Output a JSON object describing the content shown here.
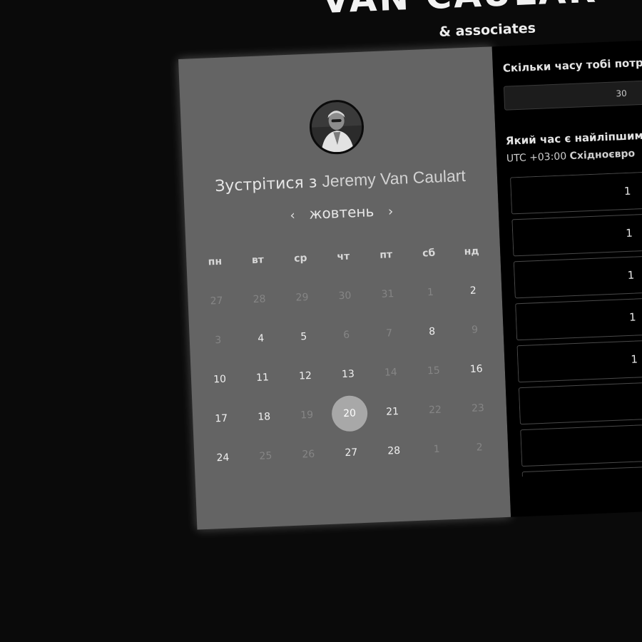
{
  "brand": {
    "title": "VAN CAULAR",
    "subtitle": "& associates"
  },
  "booking": {
    "meet_prefix": "Зустрітися з ",
    "host_name": "Jeremy Van Caulart",
    "month": "жовтень",
    "prev_icon": "chevron-left-icon",
    "next_icon": "chevron-right-icon",
    "weekdays": [
      "пн",
      "вт",
      "ср",
      "чт",
      "пт",
      "сб",
      "нд"
    ],
    "days": [
      {
        "label": "27",
        "muted": true
      },
      {
        "label": "28",
        "muted": true
      },
      {
        "label": "29",
        "muted": true
      },
      {
        "label": "30",
        "muted": true
      },
      {
        "label": "31",
        "muted": true
      },
      {
        "label": "1",
        "muted": true
      },
      {
        "label": "2",
        "muted": false
      },
      {
        "label": "3",
        "muted": true
      },
      {
        "label": "4",
        "muted": false
      },
      {
        "label": "5",
        "muted": false
      },
      {
        "label": "6",
        "muted": true
      },
      {
        "label": "7",
        "muted": true
      },
      {
        "label": "8",
        "muted": false
      },
      {
        "label": "9",
        "muted": true
      },
      {
        "label": "10",
        "muted": false
      },
      {
        "label": "11",
        "muted": false
      },
      {
        "label": "12",
        "muted": false
      },
      {
        "label": "13",
        "muted": false
      },
      {
        "label": "14",
        "muted": true
      },
      {
        "label": "15",
        "muted": true
      },
      {
        "label": "16",
        "muted": false
      },
      {
        "label": "17",
        "muted": false
      },
      {
        "label": "18",
        "muted": false
      },
      {
        "label": "19",
        "muted": true
      },
      {
        "label": "20",
        "muted": false,
        "selected": true
      },
      {
        "label": "21",
        "muted": false
      },
      {
        "label": "22",
        "muted": true
      },
      {
        "label": "23",
        "muted": true
      },
      {
        "label": "24",
        "muted": false
      },
      {
        "label": "25",
        "muted": true
      },
      {
        "label": "26",
        "muted": true
      },
      {
        "label": "27",
        "muted": false
      },
      {
        "label": "28",
        "muted": false
      },
      {
        "label": "1",
        "muted": true
      },
      {
        "label": "2",
        "muted": true
      }
    ]
  },
  "scheduler": {
    "duration_question": "Скільки часу тобі потр",
    "duration_value": "30",
    "time_question": "Який час є найліпшим",
    "timezone_offset": "UTC +03:00",
    "timezone_name": "Східноєвро",
    "slots": [
      "1",
      "1",
      "1",
      "1",
      "1",
      "",
      "",
      ""
    ]
  },
  "colors": {
    "page_bg": "#0a0a0a",
    "left_panel": "#646464",
    "right_panel": "#000000",
    "selected_day": "#a8a8a8"
  }
}
